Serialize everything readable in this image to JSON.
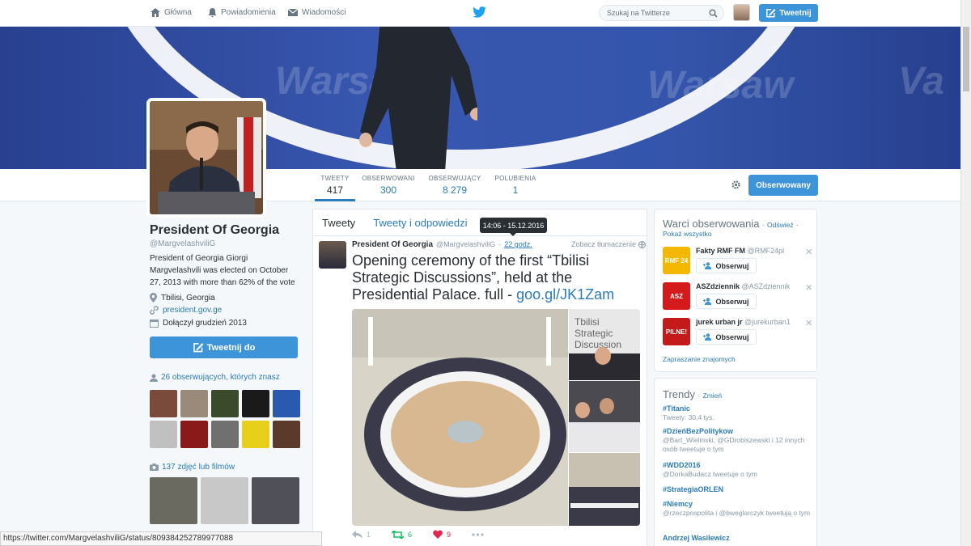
{
  "nav": {
    "home": "Główna",
    "notifications": "Powiadomienia",
    "messages": "Wiadomości",
    "search_placeholder": "Szukaj na Twitterze",
    "tweet_button": "Tweetnij"
  },
  "header": {
    "words": [
      "Warsaw",
      "Warsaw",
      "Va"
    ]
  },
  "stats": [
    {
      "label": "TWEETY",
      "value": "417"
    },
    {
      "label": "OBSERWOWANI",
      "value": "300"
    },
    {
      "label": "OBSERWUJĄCY",
      "value": "8 279"
    },
    {
      "label": "POLUBIENIA",
      "value": "1"
    }
  ],
  "follow_button": "Obserwowany",
  "profile": {
    "name": "President Of Georgia",
    "handle": "@MargvelashviliG",
    "bio": "President of Georgia Giorgi Margvelashvili was elected on October 27, 2013 with more than 62% of the vote",
    "location": "Tbilisi, Georgia",
    "website": "president.gov.ge",
    "joined": "Dołączył grudzień 2013",
    "tweet_to": "Tweetnij do",
    "mutual": "26 obserwujących, których znasz",
    "photos": "137 zdjęć lub filmów",
    "thumb_colors": [
      "#7a4a3a",
      "#9a8a7a",
      "#3a4a2a",
      "#1a1a1a",
      "#2a5ab0",
      "#c0c0c0",
      "#8a1a1a",
      "#707070",
      "#e8d01a",
      "#5a3a2a"
    ],
    "photo_colors": [
      "#6a6a60",
      "#c8c8c8",
      "#505058"
    ]
  },
  "timeline": {
    "tabs": [
      "Tweety",
      "Tweety i odpowiedzi"
    ],
    "tooltip": "14:06 - 15.12.2016",
    "tweet": {
      "name": "President Of Georgia",
      "handle": "@MargvelashviliG",
      "sep": "·",
      "time": "22 godz.",
      "translate": "Zobacz tłumaczenie",
      "text": "Opening ceremony of the first “Tbilisi Strategic Discussions”, held at the Presidential Palace. full - ",
      "link": "goo.gl/JK1Zam",
      "banner": [
        "Tbilisi",
        "Strategic",
        "Discussion"
      ],
      "replies": "1",
      "retweets": "6",
      "likes": "9"
    }
  },
  "wtf": {
    "title": "Warci obserwowania",
    "sep": "·",
    "refresh": "Odśwież",
    "sep2": "·",
    "show_all": "Pokaż wszystko",
    "items": [
      {
        "logo": "RMF 24",
        "color": "#f5b800",
        "name": "Fakty RMF FM",
        "handle": "@RMF24pl",
        "button": "Obserwuj"
      },
      {
        "logo": "ASZ",
        "color": "#d41a1a",
        "name": "ASZdziennik",
        "handle": "@ASZdziennik",
        "button": "Obserwuj"
      },
      {
        "logo": "PILNE!",
        "color": "#c41a1a",
        "name": "jurek urban jr",
        "handle": "@jurekurban1",
        "button": "Obserwuj"
      }
    ],
    "invite": "Zapraszanie znajomych"
  },
  "trends": {
    "title": "Trendy",
    "sep": "·",
    "change": "Zmień",
    "items": [
      {
        "name": "#Titanic",
        "desc": "Tweety: 30,4 tys."
      },
      {
        "name": "#DzieńBezPolitykow",
        "desc": "@Bart_Wielinski, @GDrobiszewski i 12 innych osób tweetuje o tym"
      },
      {
        "name": "#WDD2016",
        "desc": "@DorkaBudacz tweetuje o tym"
      },
      {
        "name": "#StrategiaORLEN",
        "desc": ""
      },
      {
        "name": "#Niemcy",
        "desc": "@rzeczpospolita i @bweglarczyk tweetują o tym"
      },
      {
        "name": "Andrzej Wasilewicz",
        "desc": ""
      }
    ]
  },
  "status_url": "https://twitter.com/MargvelashviliG/status/809384252789977088"
}
